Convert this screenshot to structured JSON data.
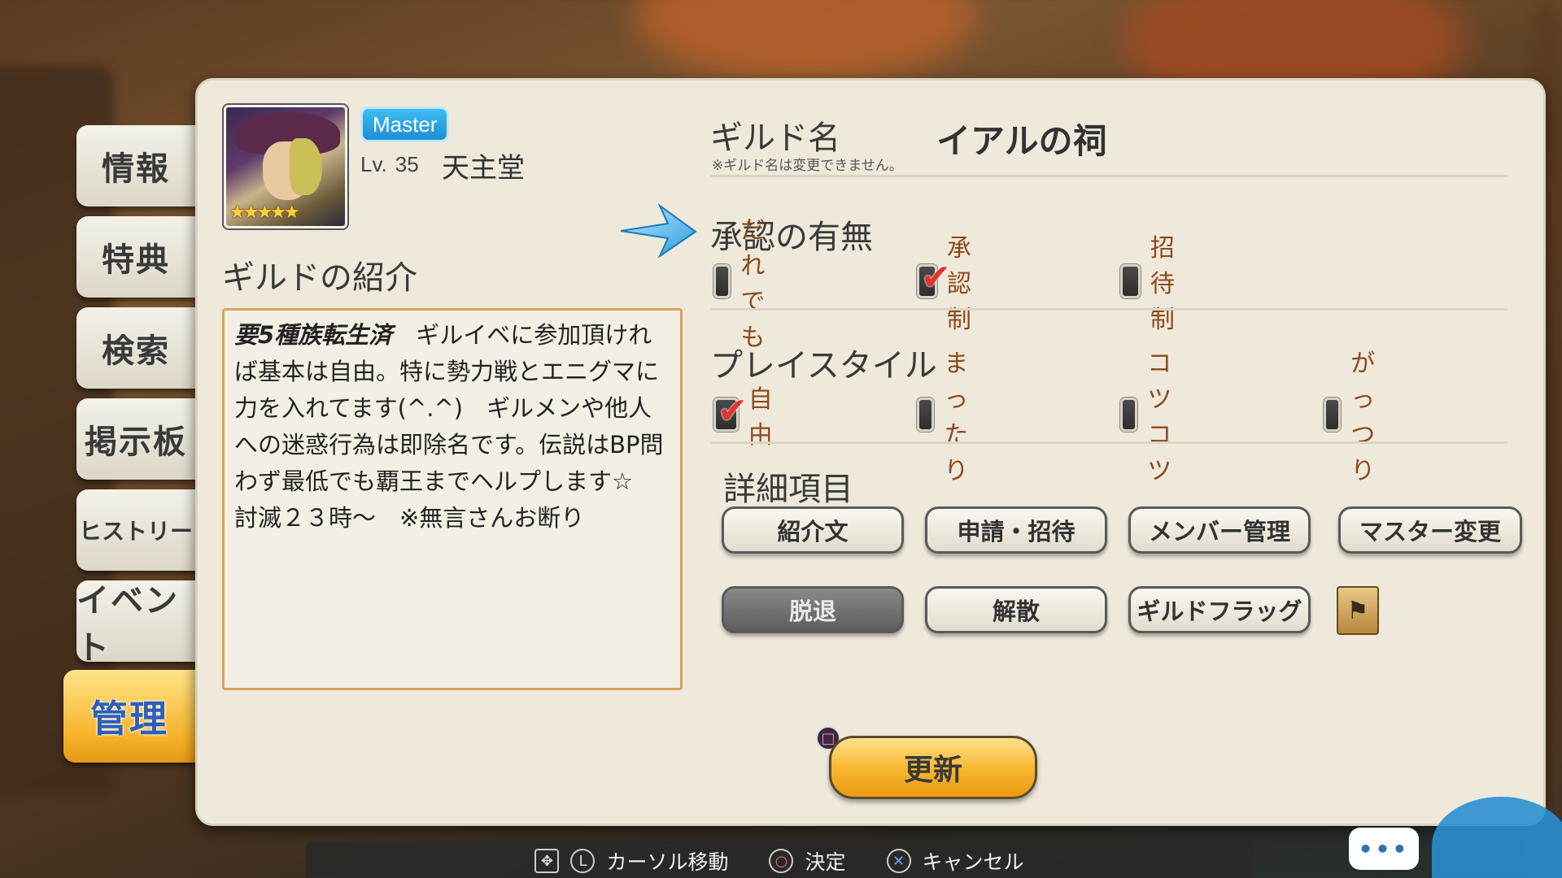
{
  "side_tabs": [
    {
      "label": "情報"
    },
    {
      "label": "特典"
    },
    {
      "label": "検索"
    },
    {
      "label": "掲示板"
    },
    {
      "label": "ヒストリー"
    },
    {
      "label": "イベント"
    },
    {
      "label": "管理",
      "active": true
    }
  ],
  "profile": {
    "role": "Master",
    "level_prefix": "Lv.",
    "level": "35",
    "name": "天主堂",
    "stars": "★★★★★"
  },
  "intro": {
    "title": "ギルドの紹介",
    "text_em": "要5種族転生済",
    "text_body": "　ギルイベに参加頂ければ基本は自由。特に勢力戦とエニグマに力を入れてます(^.^)　ギルメンや他人への迷惑行為は即除名です。伝説はBP問わず最低でも覇王までヘルプします☆　討滅２３時〜　※無言さんお断り"
  },
  "guild": {
    "label": "ギルド名",
    "note": "※ギルド名は変更できません。",
    "name": "イアルの祠"
  },
  "approval": {
    "label": "承認の有無",
    "options": [
      {
        "label": "だれでも",
        "checked": false
      },
      {
        "label": "承認制",
        "checked": true
      },
      {
        "label": "招待制",
        "checked": false
      }
    ]
  },
  "playstyle": {
    "label": "プレイスタイル",
    "options": [
      {
        "label": "自由",
        "checked": true
      },
      {
        "label": "まったり",
        "checked": false
      },
      {
        "label": "コツコツ",
        "checked": false
      },
      {
        "label": "がっつり",
        "checked": false
      }
    ]
  },
  "details": {
    "label": "詳細項目",
    "buttons": [
      "紹介文",
      "申請・招待",
      "メンバー管理",
      "マスター変更",
      "脱退",
      "解散",
      "ギルドフラッグ"
    ]
  },
  "update_label": "更新",
  "help_bar": {
    "move": "カーソル移動",
    "confirm": "決定",
    "cancel": "キャンセル"
  },
  "chat_bubble": "•••",
  "check_glyph": "✔"
}
